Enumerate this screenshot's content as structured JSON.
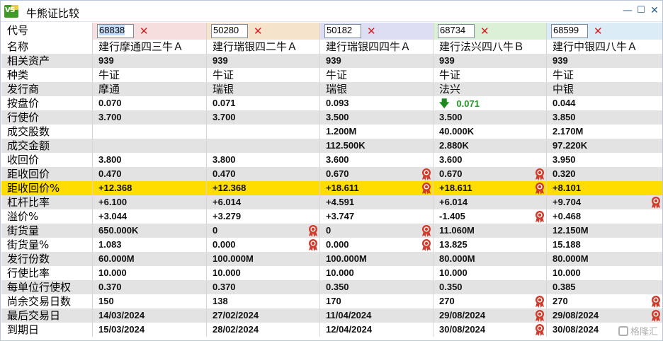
{
  "window": {
    "title": "牛熊证比较",
    "logo_text": "VS"
  },
  "products": [
    {
      "code": "68838",
      "code_bg": "#f6dede",
      "code_selected": true
    },
    {
      "code": "50280",
      "code_bg": "#f5e3cc",
      "code_selected": false
    },
    {
      "code": "50182",
      "code_bg": "#ddddf3",
      "code_selected": false
    },
    {
      "code": "68734",
      "code_bg": "#dcf0d8",
      "code_selected": false
    },
    {
      "code": "68599",
      "code_bg": "#dcecf7",
      "code_selected": false
    }
  ],
  "code_label": "代号",
  "remove_symbol": "✕",
  "rows": [
    {
      "label": "名称",
      "cjk": true,
      "values": [
        "建行摩通四三牛Ａ",
        "建行瑞银四二牛Ａ",
        "建行瑞银四四牛Ａ",
        "建行法兴四八牛Ｂ",
        "建行中银四八牛Ａ"
      ]
    },
    {
      "label": "相关资产",
      "values": [
        "939",
        "939",
        "939",
        "939",
        "939"
      ]
    },
    {
      "label": "种类",
      "cjk": true,
      "values": [
        "牛证",
        "牛证",
        "牛证",
        "牛证",
        "牛证"
      ]
    },
    {
      "label": "发行商",
      "cjk": true,
      "values": [
        "摩通",
        "瑞银",
        "瑞银",
        "法兴",
        "中银"
      ]
    },
    {
      "label": "按盘价",
      "values": [
        "0.070",
        "0.071",
        "0.093",
        "0.071",
        "0.044"
      ],
      "arrow_col": 3,
      "arrow": "🡇"
    },
    {
      "label": "行使价",
      "values": [
        "3.700",
        "3.700",
        "3.500",
        "3.500",
        "3.850"
      ]
    },
    {
      "label": "成交股数",
      "values": [
        "",
        "",
        "1.200M",
        "40.000K",
        "2.170M"
      ]
    },
    {
      "label": "成交金额",
      "values": [
        "",
        "",
        "112.500K",
        "2.880K",
        "97.220K"
      ]
    },
    {
      "label": "收回价",
      "values": [
        "3.800",
        "3.800",
        "3.600",
        "3.600",
        "3.950"
      ]
    },
    {
      "label": "距收回价",
      "values": [
        "0.470",
        "0.470",
        "0.670",
        "0.670",
        "0.320"
      ],
      "medals": [
        2,
        3
      ]
    },
    {
      "label": "距收回价%",
      "values": [
        "+12.368",
        "+12.368",
        "+18.611",
        "+18.611",
        "+8.101"
      ],
      "medals": [
        2,
        3
      ],
      "highlight": true
    },
    {
      "label": "杠杆比率",
      "values": [
        "+6.100",
        "+6.014",
        "+4.591",
        "+6.014",
        "+9.704"
      ],
      "medals": [
        4
      ]
    },
    {
      "label": "溢价%",
      "values": [
        "+3.044",
        "+3.279",
        "+3.747",
        "-1.405",
        "+0.468"
      ],
      "medals": [
        3
      ]
    },
    {
      "label": "街货量",
      "values": [
        "650.000K",
        "0",
        "0",
        "11.060M",
        "12.150M"
      ],
      "medals": [
        1,
        2
      ]
    },
    {
      "label": "街货量%",
      "values": [
        "1.083",
        "0.000",
        "0.000",
        "13.825",
        "15.188"
      ],
      "medals": [
        1,
        2
      ]
    },
    {
      "label": "发行份数",
      "values": [
        "60.000M",
        "100.000M",
        "100.000M",
        "80.000M",
        "80.000M"
      ]
    },
    {
      "label": "行使比率",
      "values": [
        "10.000",
        "10.000",
        "10.000",
        "10.000",
        "10.000"
      ]
    },
    {
      "label": "每单位行使权",
      "values": [
        "0.370",
        "0.370",
        "0.350",
        "0.350",
        "0.385"
      ]
    },
    {
      "label": "尚余交易日数",
      "values": [
        "150",
        "138",
        "170",
        "270",
        "270"
      ],
      "medals": [
        3,
        4
      ]
    },
    {
      "label": "最后交易日",
      "values": [
        "14/03/2024",
        "27/02/2024",
        "11/04/2024",
        "29/08/2024",
        "29/08/2024"
      ],
      "medals": [
        3,
        4
      ]
    },
    {
      "label": "到期日",
      "values": [
        "15/03/2024",
        "28/02/2024",
        "12/04/2024",
        "30/08/2024",
        "30/08/2024"
      ],
      "medals": [
        3
      ]
    }
  ],
  "colors": {
    "highlight_row": "#ffdd00",
    "alt_row": "#e3e3e3",
    "remove_x": "#d42020",
    "medal": "#d23a2a",
    "up_down_green": "#1c9a1c"
  },
  "watermark": "格隆汇"
}
